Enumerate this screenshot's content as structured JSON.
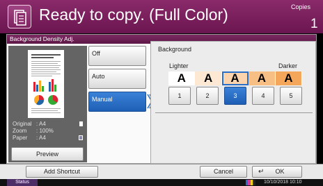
{
  "header": {
    "title": "Ready to copy. (Full Color)",
    "copies_label": "Copies",
    "copies_count": "1"
  },
  "panel": {
    "title": "Background Density Adj."
  },
  "preview": {
    "original_label": "Original",
    "original_value": ": A4",
    "zoom_label": "Zoom",
    "zoom_value": ": 100%",
    "paper_label": "Paper",
    "paper_value": ": A4",
    "preview_button": "Preview",
    "doc_title": "Exploring Data Base From New Sources"
  },
  "modes": {
    "off": "Off",
    "auto": "Auto",
    "manual": "Manual",
    "selected": "manual"
  },
  "settings": {
    "label": "Background",
    "lighter": "Lighter",
    "darker": "Darker",
    "scale_letter": "A",
    "levels": [
      "1",
      "2",
      "3",
      "4",
      "5"
    ],
    "selected_level": 3,
    "scale_colors": [
      "#ffffff",
      "#fde8d4",
      "#fbd4ad",
      "#f8bf85",
      "#f4a65a"
    ]
  },
  "bottom": {
    "add_shortcut": "Add Shortcut",
    "cancel": "Cancel",
    "ok": "OK"
  },
  "status": {
    "tab": "Status",
    "datetime": "10/10/2018 10:10"
  },
  "colors": {
    "brand": "#7d2360",
    "accent": "#2a6fc7"
  }
}
